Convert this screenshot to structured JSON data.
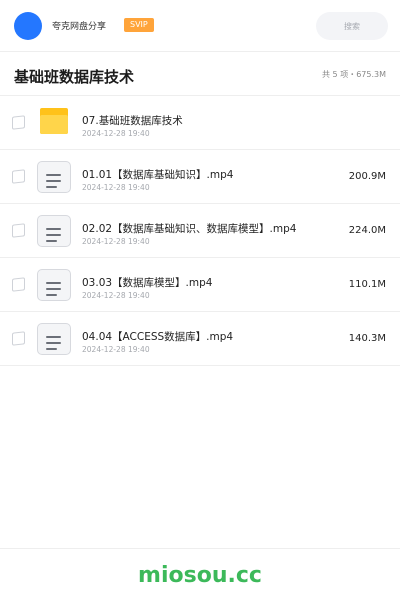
{
  "header": {
    "account_name": "夸克网盘分享",
    "badge": "SVIP",
    "search_placeholder": "搜索"
  },
  "folder": {
    "title": "基础班数据库技术",
    "summary": "共 5 项・675.3M"
  },
  "items": [
    {
      "type": "folder",
      "name": "07.基础班数据库技术",
      "date": "2024-12-28 19:40",
      "size": ""
    },
    {
      "type": "file",
      "name": "01.01【数据库基础知识】.mp4",
      "date": "2024-12-28 19:40",
      "size": "200.9M"
    },
    {
      "type": "file",
      "name": "02.02【数据库基础知识、数据库模型】.mp4",
      "date": "2024-12-28 19:40",
      "size": "224.0M"
    },
    {
      "type": "file",
      "name": "03.03【数据库模型】.mp4",
      "date": "2024-12-28 19:40",
      "size": "110.1M"
    },
    {
      "type": "file",
      "name": "04.04【ACCESS数据库】.mp4",
      "date": "2024-12-28 19:40",
      "size": "140.3M"
    }
  ],
  "footer": {
    "watermark": "miosou.cc"
  },
  "colors": {
    "avatar": "#2477ff",
    "badge": "#ffa43a",
    "folder": "#ffc21a",
    "watermark": "#3cb95a"
  }
}
